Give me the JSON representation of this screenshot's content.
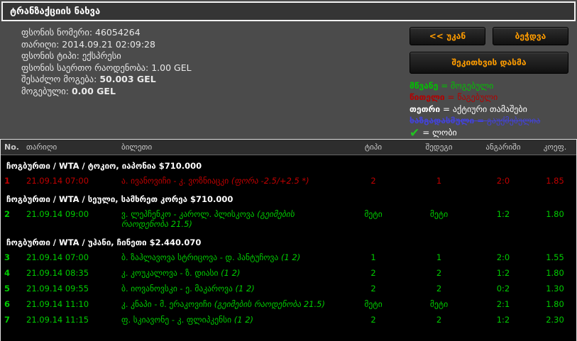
{
  "title": "ტრანზაქციის ნახვა",
  "info": {
    "lines": [
      {
        "label": "ფსონის ნომერი:",
        "value": "46054264"
      },
      {
        "label": "თარიღი:",
        "value": "2014.09.21 02:09:28"
      },
      {
        "label": "ფსონის ტიპი:",
        "value": "ექსპრესი"
      },
      {
        "label": "ფსონის საერთო რაოდენობა:",
        "value": "1.00 GEL"
      },
      {
        "label": "შესაძლო მოგება:",
        "value": "50.003 GEL"
      },
      {
        "label": "მოგებული:",
        "value": "0.00 GEL"
      }
    ]
  },
  "buttons": {
    "back": "<< უკან",
    "print": "ბეჭდვა",
    "ask": "შეკითხვის დასმა"
  },
  "legend": [
    {
      "term": "მწვანე",
      "rest": "= მოგებული",
      "color": "#00c400"
    },
    {
      "term": "წითელი",
      "rest": "= წაგებული",
      "color": "#b30000"
    },
    {
      "term": "თეთრი",
      "rest": "= აქტიური თამაშები",
      "color": "#ffffff"
    },
    {
      "term": "ხაზგადასმული",
      "rest": "= გაუქმებულია",
      "color": "#4343d8"
    },
    {
      "icon": "check-icon",
      "check_glyph": "✔",
      "rest": "= ლობი",
      "color": "#21c421"
    }
  ],
  "table": {
    "headers": [
      "No.",
      "თარიღი",
      "ბილეთი",
      "ტიპი",
      "შედეგი",
      "ანგარიში",
      "კოეფ."
    ],
    "groups": [
      {
        "header": "ჩოგბურთი / WTA / ტოკიო, იაპონია $710.000",
        "rows": [
          {
            "no": "1",
            "date": "21.09.14 07:00",
            "ticket": "ა. ივანოვიჩი - კ. ვოზნიაცკი",
            "note": "(ფორა -2.5/+2.5 *)",
            "type": "2",
            "result": "1",
            "score": "2:0",
            "coef": "1.85",
            "status": "lost"
          }
        ]
      },
      {
        "header": "ჩოგბურთი / WTA / სეული, სამხრეთ კორეა $710.000",
        "rows": [
          {
            "no": "2",
            "date": "21.09.14 09:00",
            "ticket": "ვ. ლეპჩენკო - კაროლ. პლისკოვა",
            "note": "(გეიმების რაოდენობა 21.5)",
            "type": "მეტი",
            "result": "მეტი",
            "score": "1:2",
            "coef": "1.80",
            "status": "won"
          }
        ]
      },
      {
        "header": "ჩოგბურთი / WTA / უჰანი, ჩინეთი $2.440.070",
        "rows": [
          {
            "no": "3",
            "date": "21.09.14 07:00",
            "ticket": "ბ. ზაჰლავოვა სტრიცოვა - დ. ჰანტუჩოვა",
            "note": "(1 2)",
            "type": "1",
            "result": "1",
            "score": "2:0",
            "coef": "1.55",
            "status": "won"
          },
          {
            "no": "4",
            "date": "21.09.14 08:35",
            "ticket": "კ. კოუკალოვა - ზ. დიასი",
            "note": "(1 2)",
            "type": "2",
            "result": "2",
            "score": "1:2",
            "coef": "1.80",
            "status": "won"
          },
          {
            "no": "5",
            "date": "21.09.14 09:55",
            "ticket": "ბ. იოვანოვსკი - ე. მაკაროვა",
            "note": "(1 2)",
            "type": "2",
            "result": "2",
            "score": "0:2",
            "coef": "1.30",
            "status": "won"
          },
          {
            "no": "6",
            "date": "21.09.14 11:10",
            "ticket": "კ. კნაპი - მ. ერაკოვიჩი",
            "note": "(გეიმების რაოდენობა 21.5)",
            "type": "მეტი",
            "result": "მეტი",
            "score": "2:1",
            "coef": "1.80",
            "status": "won"
          },
          {
            "no": "7",
            "date": "21.09.14 11:15",
            "ticket": "ფ. სკიავონე - კ. ფლიპკენსი",
            "note": "(1 2)",
            "type": "2",
            "result": "2",
            "score": "1:2",
            "coef": "2.30",
            "status": "won"
          }
        ]
      }
    ]
  },
  "colors": {
    "won": "#00cc00",
    "lost": "#c00000",
    "active": "#ffffff",
    "cancelled": "#4343d8",
    "button_text": "#ff9c00"
  }
}
